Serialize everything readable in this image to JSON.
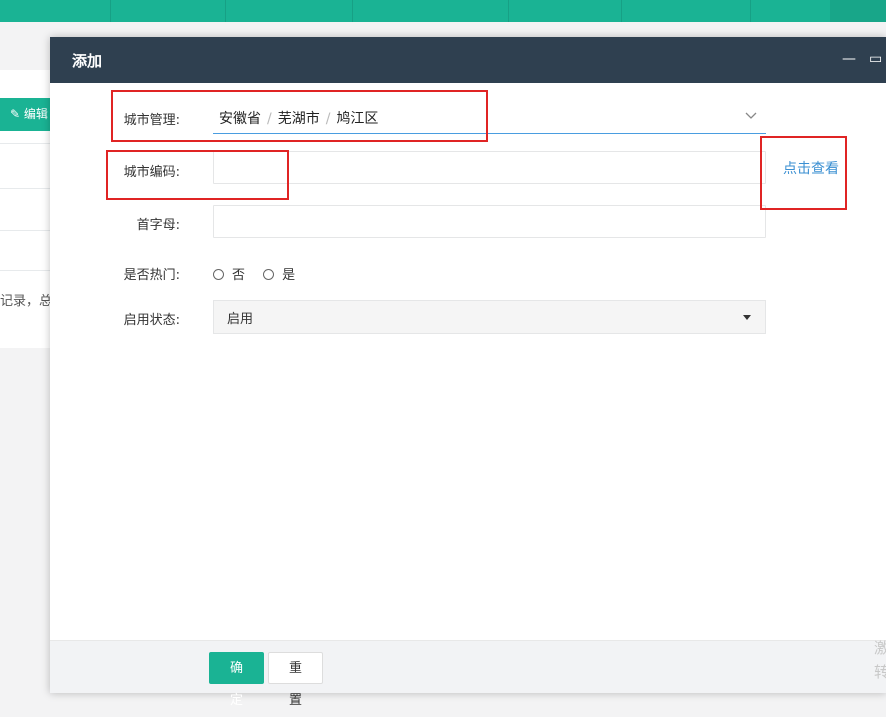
{
  "background": {
    "edit_button": "✎ 编辑",
    "record_text": "记录，总"
  },
  "modal": {
    "title": "添加",
    "minimize": "—",
    "maximize": "▭",
    "form": {
      "city_manage_label": "城市管理:",
      "city_path": [
        "安徽省",
        "芜湖市",
        "鸠江区"
      ],
      "city_code_label": "城市编码:",
      "city_code_value": "",
      "view_link": "点击查看",
      "initial_label": "首字母:",
      "initial_value": "",
      "hot_label": "是否热门:",
      "hot_options": [
        "否",
        "是"
      ],
      "status_label": "启用状态:",
      "status_value": "启用"
    },
    "footer": {
      "confirm": "确定",
      "reset": "重置"
    }
  },
  "watermark": [
    "激",
    "转"
  ],
  "colors": {
    "primary": "#1ab394",
    "header": "#2f4050",
    "link": "#3a8fd2",
    "highlight": "#e02424"
  }
}
